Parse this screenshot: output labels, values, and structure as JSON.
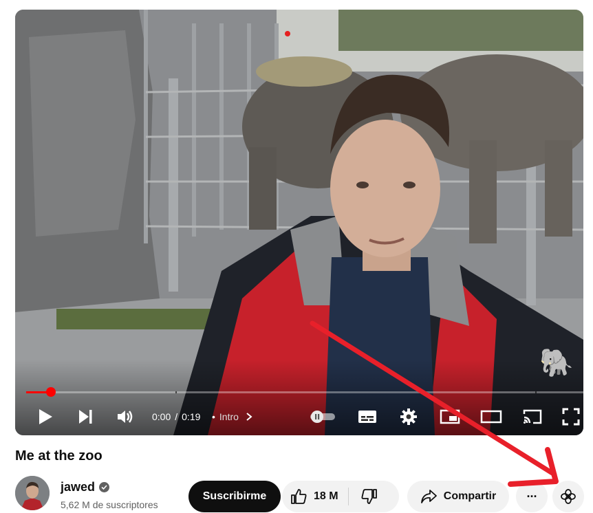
{
  "video": {
    "title": "Me at the zoo",
    "current_time": "0:00",
    "time_separator": "/",
    "duration": "0:19",
    "chapter_label": "Intro",
    "progress_fraction": 0.044,
    "badge_emoji": "🐘"
  },
  "channel": {
    "name": "jawed",
    "subscribers": "5,62 M de suscriptores"
  },
  "actions": {
    "subscribe_label": "Suscribirme",
    "like_count": "18 M",
    "share_label": "Compartir",
    "more_label": "···"
  },
  "icons": {
    "play": "play-icon",
    "next": "next-icon",
    "volume": "volume-icon",
    "autoplay": "autoplay-toggle-icon",
    "captions": "subtitles-icon",
    "settings": "gear-icon",
    "miniplayer": "miniplayer-icon",
    "theater": "theater-mode-icon",
    "cast": "cast-icon",
    "fullscreen": "fullscreen-icon",
    "like": "thumbs-up-icon",
    "dislike": "thumbs-down-icon",
    "share": "share-arrow-icon",
    "ai": "ai-sparkle-icon"
  },
  "colors": {
    "progress_red": "#ff0000",
    "annotation_arrow": "#e8202a",
    "button_dark": "#0f0f0f",
    "pill_bg": "#f2f2f2"
  }
}
